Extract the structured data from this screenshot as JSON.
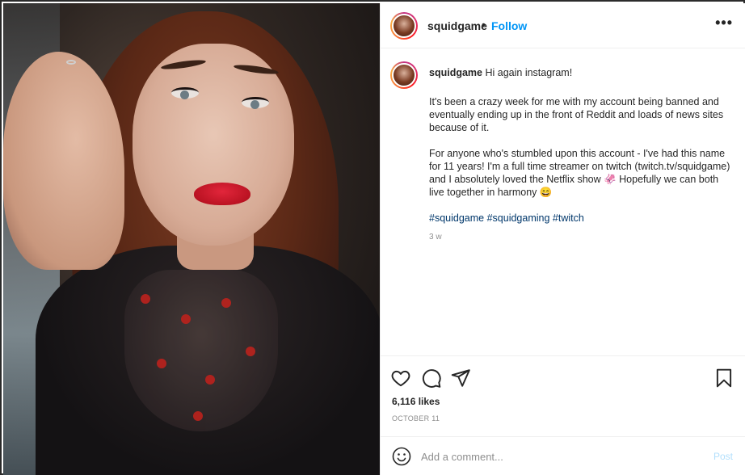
{
  "post": {
    "username": "squidgame",
    "separator": "•",
    "follow_label": "Follow",
    "more_label": "•••",
    "caption": {
      "username": "squidgame",
      "first_line": "Hi again instagram!",
      "paragraph_1": "It's been a crazy week for me with my account being banned and eventually ending up in the front of Reddit and loads of news sites because of it.",
      "paragraph_2": "For anyone who's stumbled upon this account - I've had this name for 11 years! I'm a full time streamer on twitch (twitch.tv/squidgame) and I absolutely loved the Netflix show 🦑 Hopefully we can both live together in harmony 😄",
      "hashtags": [
        "#squidgame",
        "#squidgaming",
        "#twitch"
      ]
    },
    "time_ago": "3 w",
    "likes": "6,116 likes",
    "date": "OCTOBER 11"
  },
  "comment": {
    "placeholder": "Add a comment...",
    "post_label": "Post"
  },
  "icons": {
    "like": "heart-icon",
    "comment": "comment-bubble-icon",
    "share": "paper-plane-icon",
    "save": "bookmark-icon",
    "emoji": "smiley-icon"
  },
  "colors": {
    "follow": "#0095f6",
    "hashtag": "#00376b",
    "post_disabled": "#b2dffc",
    "muted": "#8e8e8e"
  }
}
